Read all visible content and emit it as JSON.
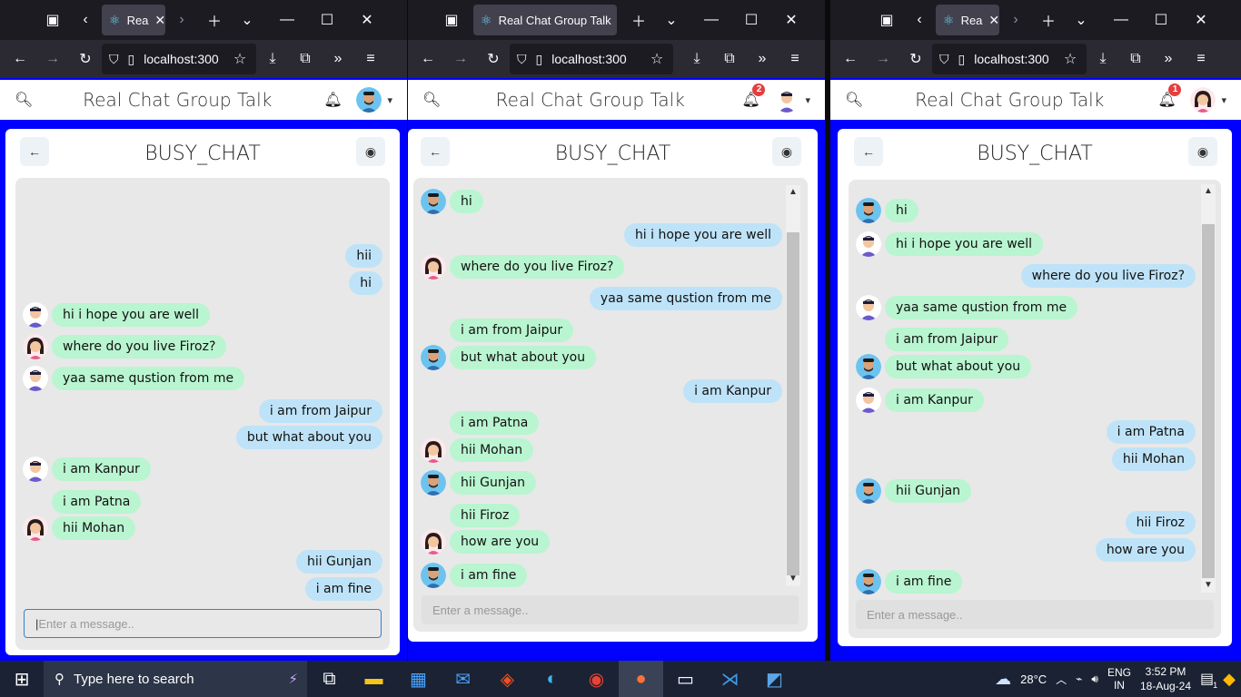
{
  "browser": {
    "tab_label_short": "Rea",
    "tab_label_full": "Real Chat Group Talk",
    "url": "localhost:300",
    "react_icon": "react-icon",
    "url_suffix_w2": "localhost:300"
  },
  "app": {
    "title": "Real Chat Group Talk",
    "chat_name": "BUSY_CHAT",
    "input_placeholder": "Enter a message..",
    "colors": {
      "incoming": "#b9f5d0",
      "outgoing": "#bee3f8",
      "background": "#0000ff",
      "accent": "#3182ce"
    }
  },
  "windows": [
    {
      "badge": "",
      "me_avatar": "man-blue",
      "messages": [
        {
          "text": "hii",
          "side": "out",
          "avatar": ""
        },
        {
          "text": "hi",
          "side": "out",
          "avatar": ""
        },
        {
          "text": "hi i hope you are well",
          "side": "in",
          "avatar": "man-purple"
        },
        {
          "text": "where do you live Firoz?",
          "side": "in",
          "avatar": "woman"
        },
        {
          "text": "yaa same qustion from me",
          "side": "in",
          "avatar": "man-purple"
        },
        {
          "text": "i am from Jaipur",
          "side": "out",
          "avatar": ""
        },
        {
          "text": "but what about you",
          "side": "out",
          "avatar": ""
        },
        {
          "text": "i am Kanpur",
          "side": "in",
          "avatar": "man-purple"
        },
        {
          "text": "i am Patna",
          "side": "in",
          "avatar": ""
        },
        {
          "text": "hii Mohan",
          "side": "in",
          "avatar": "woman"
        },
        {
          "text": "hii Gunjan",
          "side": "out",
          "avatar": ""
        },
        {
          "text": "i am fine",
          "side": "out",
          "avatar": ""
        }
      ]
    },
    {
      "badge": "2",
      "me_avatar": "man-purple",
      "messages": [
        {
          "text": "hi",
          "side": "in",
          "avatar": "man-blue"
        },
        {
          "text": "hi i hope you are well",
          "side": "out",
          "avatar": ""
        },
        {
          "text": "where do you live Firoz?",
          "side": "in",
          "avatar": "woman"
        },
        {
          "text": "yaa same qustion from me",
          "side": "out",
          "avatar": ""
        },
        {
          "text": "i am from Jaipur",
          "side": "in",
          "avatar": ""
        },
        {
          "text": "but what about you",
          "side": "in",
          "avatar": "man-blue"
        },
        {
          "text": "i am Kanpur",
          "side": "out",
          "avatar": ""
        },
        {
          "text": "i am Patna",
          "side": "in",
          "avatar": ""
        },
        {
          "text": "hii Mohan",
          "side": "in",
          "avatar": "woman"
        },
        {
          "text": "hii Gunjan",
          "side": "in",
          "avatar": "man-blue"
        },
        {
          "text": "hii Firoz",
          "side": "in",
          "avatar": ""
        },
        {
          "text": "how are you",
          "side": "in",
          "avatar": "woman"
        },
        {
          "text": "i am fine",
          "side": "in",
          "avatar": "man-blue"
        }
      ]
    },
    {
      "badge": "1",
      "me_avatar": "woman",
      "messages": [
        {
          "text": "hi",
          "side": "in",
          "avatar": "man-blue"
        },
        {
          "text": "hi i hope you are well",
          "side": "in",
          "avatar": "man-purple"
        },
        {
          "text": "where do you live Firoz?",
          "side": "out",
          "avatar": ""
        },
        {
          "text": "yaa same qustion from me",
          "side": "in",
          "avatar": "man-purple"
        },
        {
          "text": "i am from Jaipur",
          "side": "in",
          "avatar": ""
        },
        {
          "text": "but what about you",
          "side": "in",
          "avatar": "man-blue"
        },
        {
          "text": "i am Kanpur",
          "side": "in",
          "avatar": "man-purple"
        },
        {
          "text": "i am Patna",
          "side": "out",
          "avatar": ""
        },
        {
          "text": "hii Mohan",
          "side": "out",
          "avatar": ""
        },
        {
          "text": "hii Gunjan",
          "side": "in",
          "avatar": "man-blue"
        },
        {
          "text": "hii Firoz",
          "side": "out",
          "avatar": ""
        },
        {
          "text": "how are you",
          "side": "out",
          "avatar": ""
        },
        {
          "text": "i am fine",
          "side": "in",
          "avatar": "man-blue"
        }
      ]
    }
  ],
  "taskbar": {
    "search_placeholder": "Type here to search",
    "weather": "28°C",
    "lang_top": "ENG",
    "lang_bottom": "IN",
    "time": "3:52 PM",
    "date": "18-Aug-24",
    "notif_count": "1"
  }
}
